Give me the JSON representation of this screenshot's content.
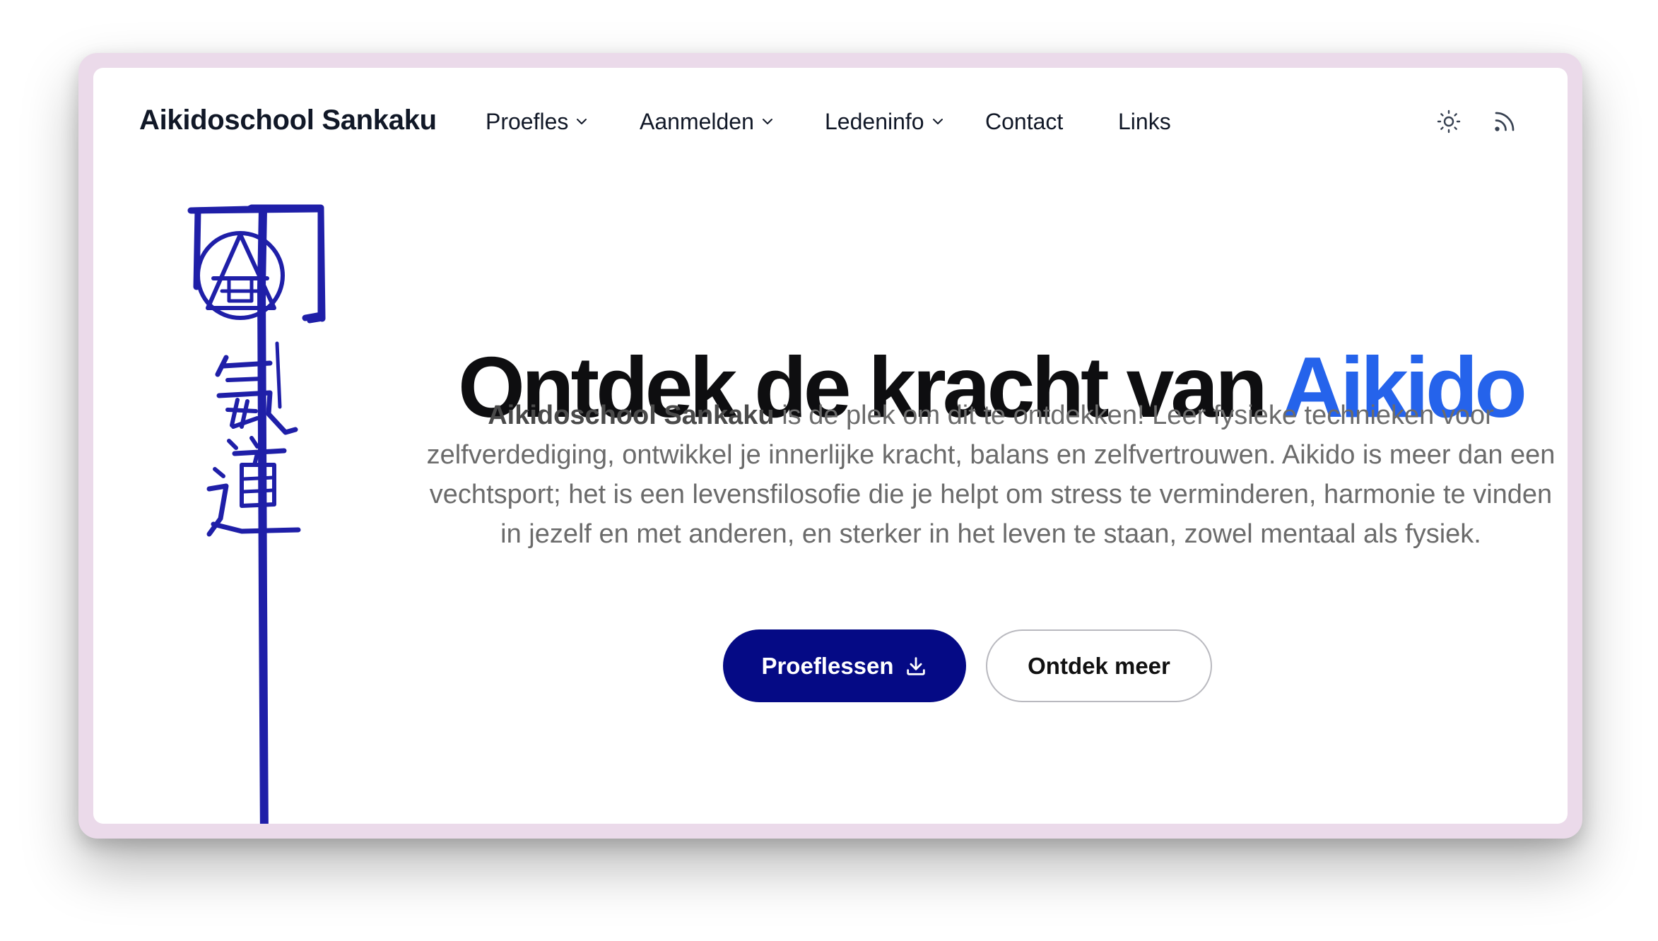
{
  "header": {
    "logo": "Aikidoschool Sankaku",
    "nav": [
      {
        "label": "Proefles",
        "has_dropdown": true
      },
      {
        "label": "Aanmelden",
        "has_dropdown": true
      },
      {
        "label": "Ledeninfo",
        "has_dropdown": true
      },
      {
        "label": "Contact",
        "has_dropdown": false
      },
      {
        "label": "Links",
        "has_dropdown": false
      }
    ],
    "icons": [
      "sun-icon",
      "rss-icon"
    ]
  },
  "hero": {
    "title_main": "Ontdek de kracht van",
    "title_accent": "Aikido",
    "intro_bold": "Aikidoschool Sankaku",
    "intro_text": " is de plek om dit te ontdekken! Leer fysieke technieken voor zelfverdediging, ontwikkel je innerlijke kracht, balans en zelfvertrouwen. Aikido is meer dan een vechtsport; het is een levensfilosofie die je helpt om stress te verminderen, harmonie te vinden in jezelf en met anderen, en sterker in het leven te staan, zowel mentaal als fysiek.",
    "primary_button": "Proeflessen",
    "secondary_button": "Ontdek meer"
  },
  "colors": {
    "accent": "#2563eb",
    "primary_button": "#050a85",
    "calligraphy": "#1f1fa8",
    "frame": "#ebdaea"
  }
}
